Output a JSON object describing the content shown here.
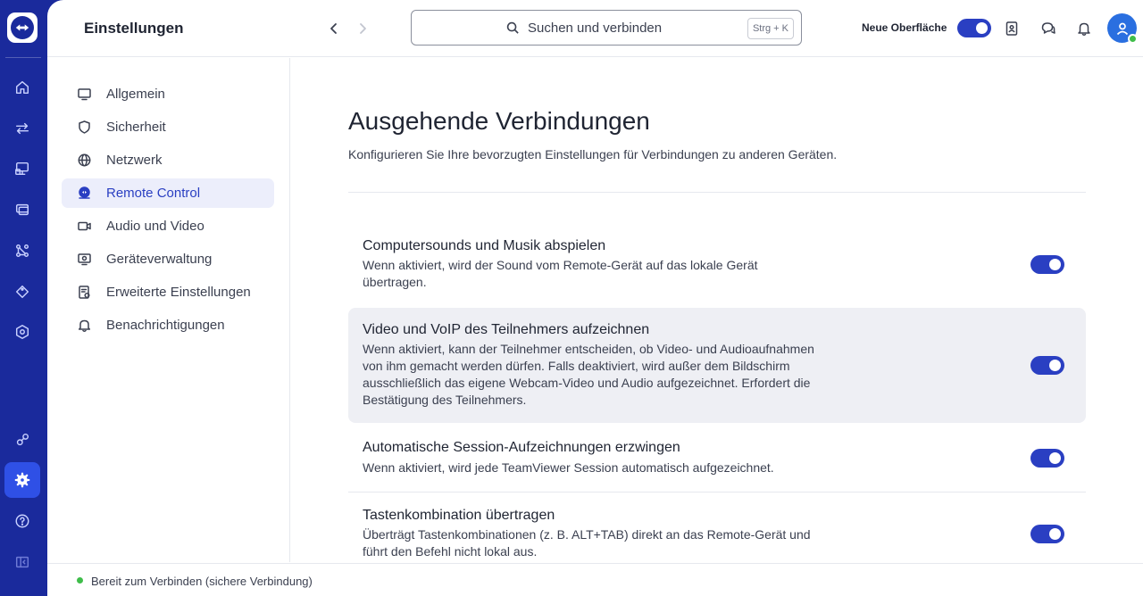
{
  "header": {
    "title": "Einstellungen",
    "search_placeholder": "Suchen und verbinden",
    "search_shortcut": "Strg + K",
    "new_ui_label": "Neue Oberfläche",
    "new_ui_enabled": true
  },
  "rail": {
    "items": [
      "home-icon",
      "transfer-icon",
      "remote-devices-icon",
      "sessions-icon",
      "workflow-icon",
      "tag-icon",
      "deploy-icon",
      "integrations-icon",
      "settings-icon",
      "help-icon",
      "collapse-icon"
    ],
    "active": "settings-icon"
  },
  "settings_nav": {
    "items": [
      {
        "label": "Allgemein",
        "icon": "monitor-icon"
      },
      {
        "label": "Sicherheit",
        "icon": "shield-icon"
      },
      {
        "label": "Netzwerk",
        "icon": "globe-icon"
      },
      {
        "label": "Remote Control",
        "icon": "remote-control-icon"
      },
      {
        "label": "Audio und Video",
        "icon": "video-icon"
      },
      {
        "label": "Geräteverwaltung",
        "icon": "device-management-icon"
      },
      {
        "label": "Erweiterte Einstellungen",
        "icon": "advanced-settings-icon"
      },
      {
        "label": "Benachrichtigungen",
        "icon": "bell-icon"
      }
    ],
    "active": "Remote Control"
  },
  "main": {
    "title": "Ausgehende Verbindungen",
    "subtitle": "Konfigurieren Sie Ihre bevorzugten Einstellungen für Verbindungen zu anderen Geräten.",
    "settings": [
      {
        "title": "Computersounds und Musik abspielen",
        "description": "Wenn aktiviert, wird der Sound vom Remote-Gerät auf das lokale Gerät übertragen.",
        "enabled": true
      },
      {
        "title": "Video und VoIP des Teilnehmers aufzeichnen",
        "description": "Wenn aktiviert, kann der Teilnehmer entscheiden, ob Video- und Audioaufnahmen von ihm gemacht werden dürfen. Falls deaktiviert, wird außer dem Bildschirm ausschließlich das eigene Webcam-Video und Audio aufgezeichnet. Erfordert die Bestätigung des Teilnehmers.",
        "enabled": true
      },
      {
        "title": "Automatische Session-Aufzeichnungen erzwingen",
        "description": "Wenn aktiviert, wird jede TeamViewer Session automatisch aufgezeichnet.",
        "enabled": true
      },
      {
        "title": "Tastenkombination übertragen",
        "description": "Überträgt Tastenkombinationen (z. B. ALT+TAB) direkt an das Remote-Gerät und führt den Befehl nicht lokal aus.",
        "enabled": true
      }
    ]
  },
  "status": {
    "text": "Bereit zum Verbinden (sichere Verbindung)",
    "color": "#3fbd4a"
  },
  "colors": {
    "brand": "#1a2a9c",
    "accent": "#2a3fc2",
    "active_bg": "#eceefb"
  }
}
